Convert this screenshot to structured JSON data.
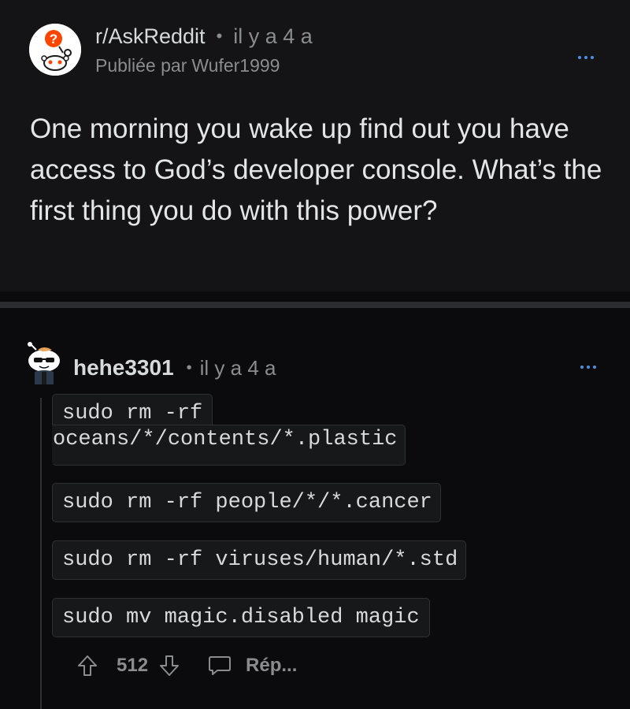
{
  "post": {
    "subreddit": "r/AskReddit",
    "separator": "•",
    "age": "il y a 4 a",
    "author_prefix": "Publiée par",
    "author": "Wufer1999",
    "title": "One morning you wake up find out you have access to God’s developer console. What’s the first thing you do with this power?"
  },
  "comment": {
    "author": "hehe3301",
    "separator": "•",
    "age": "il y a 4 a",
    "code_lines": [
      {
        "line1": "sudo rm -rf",
        "line2": "oceans/*/contents/*.plastic"
      },
      {
        "text": "sudo rm -rf people/*/*.cancer"
      },
      {
        "text": "sudo rm -rf viruses/human/*.std"
      },
      {
        "text": "sudo mv magic.disabled magic"
      }
    ],
    "votes": "512",
    "reply_label": "Rép..."
  },
  "icons": {
    "post_avatar": "reddit-snoo-question-icon",
    "post_more": "more-dots-icon",
    "comment_avatar": "snoo-sunglasses-avatar-icon",
    "comment_more": "more-dots-icon",
    "upvote": "upvote-arrow-icon",
    "downvote": "downvote-arrow-icon",
    "reply": "speech-bubble-icon"
  },
  "colors": {
    "background": "#0b0b0d",
    "post_background": "#141416",
    "primary_text": "#d7dadc",
    "muted_text": "#8a8c8f",
    "accent_blue": "#4f8fe0",
    "code_background": "#17181a"
  }
}
